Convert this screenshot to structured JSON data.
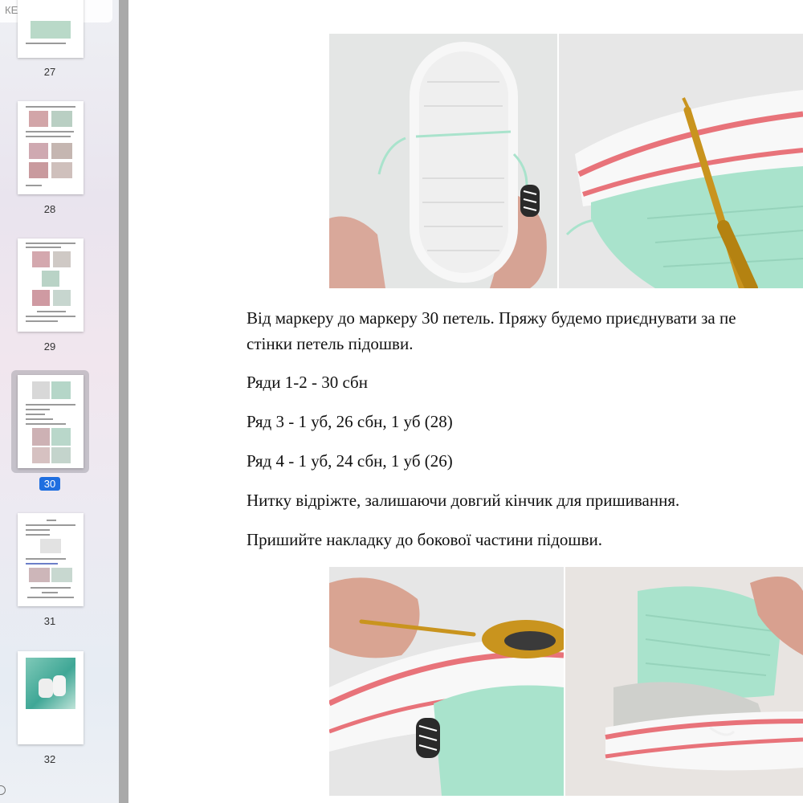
{
  "sidebar": {
    "search_text": "КЕДИ ДЛЯ НЕ...",
    "thumbnails": [
      {
        "label": "27"
      },
      {
        "label": "28"
      },
      {
        "label": "29"
      },
      {
        "label": "30"
      },
      {
        "label": "31"
      },
      {
        "label": "32"
      }
    ],
    "selected_page": "30"
  },
  "document": {
    "paragraphs": [
      "Від маркеру до маркеру 30 петель. Пряжу будемо приєднувати за пе",
      "стінки петель підошви.",
      "Ряди 1-2 - 30 сбн",
      "Ряд 3 - 1 уб, 26 сбн, 1 уб (28)",
      "Ряд 4 - 1 уб, 24 сбн, 1 уб (26)",
      "Нитку відріжте, залишаючи довгий кінчик для пришивання.",
      "Пришийте накладку до бокової частини підошви."
    ]
  },
  "colors": {
    "mint": "#a9e3cc",
    "coral": "#e8737a",
    "hook_gold": "#c9941e",
    "selection_blue": "#1f6fe0"
  }
}
